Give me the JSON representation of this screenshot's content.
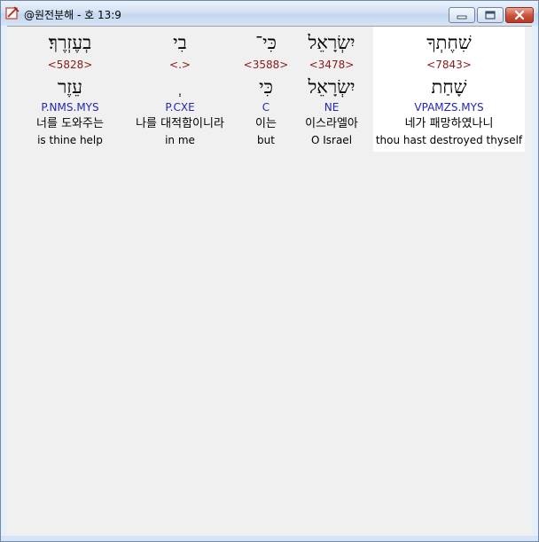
{
  "window": {
    "title": "@원전분해 - 호 13:9"
  },
  "words": [
    {
      "hebrew": "שִׁחֶתְךָ",
      "strong": "<7843>",
      "hebrew_root": "שָׁחַת",
      "morph": "VPAMZS.MYS",
      "korean": "네가 패망하였나니",
      "english": "thou hast destroyed thyself",
      "selected": true
    },
    {
      "hebrew": "יִשְׂרָאֵל",
      "strong": "<3478>",
      "hebrew_root": "יִשְׂרָאֵל",
      "morph": "NE",
      "korean": "이스라엘아",
      "english": "O Israel",
      "selected": false
    },
    {
      "hebrew": "כִּי־",
      "strong": "<3588>",
      "hebrew_root": "כִּי",
      "morph": "C",
      "korean": "이는",
      "english": "but",
      "selected": false
    },
    {
      "hebrew": "בִי",
      "strong": "<.>",
      "hebrew_root": "ְ",
      "morph": "P.CXE",
      "korean": "나를 대적함이니라",
      "english": "in me",
      "selected": false
    },
    {
      "hebrew": "בְעֶזְרֶךָ׃",
      "strong": "<5828>",
      "hebrew_root": "עֵזֶר",
      "morph": "P.NMS.MYS",
      "korean": "너를 도와주는",
      "english": "is thine help",
      "selected": false
    }
  ]
}
